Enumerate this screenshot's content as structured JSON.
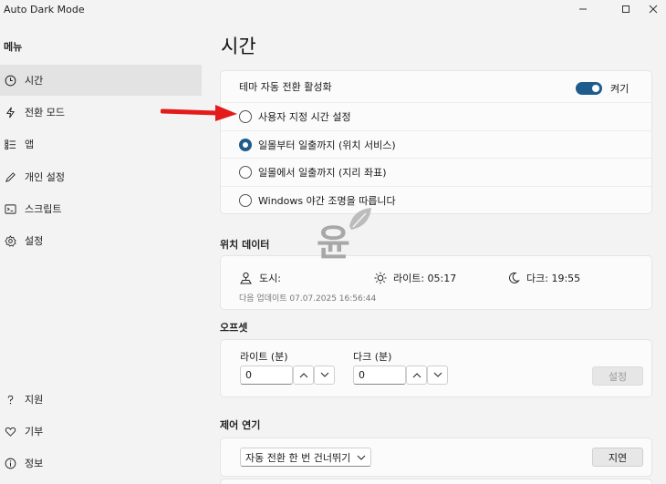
{
  "window": {
    "title": "Auto Dark Mode",
    "controls": [
      "minimize-icon",
      "maximize-icon",
      "close-icon"
    ]
  },
  "sidebar": {
    "heading": "메뉴",
    "items": [
      {
        "label": "시간",
        "icon": "clock-icon",
        "active": true
      },
      {
        "label": "전환 모드",
        "icon": "lightning-icon"
      },
      {
        "label": "앱",
        "icon": "app-list-icon"
      },
      {
        "label": "개인 설정",
        "icon": "pen-icon"
      },
      {
        "label": "스크립트",
        "icon": "script-icon"
      },
      {
        "label": "설정",
        "icon": "gear-icon"
      }
    ],
    "footer": [
      {
        "label": "지원",
        "icon": "help-icon"
      },
      {
        "label": "기부",
        "icon": "heart-icon"
      },
      {
        "label": "정보",
        "icon": "info-icon"
      }
    ]
  },
  "main": {
    "title": "시간",
    "theme_switch": {
      "label": "테마 자동 전환 활성화",
      "state_label": "켜기",
      "on": true
    },
    "schedule_options": [
      {
        "label": "사용자 지정 시간 설정",
        "checked": false
      },
      {
        "label": "일몰부터 일출까지 (위치 서비스)",
        "checked": true
      },
      {
        "label": "일몰에서 일출까지 (지리 좌표)",
        "checked": false
      },
      {
        "label": "Windows 야간 조명을 따릅니다",
        "checked": false
      }
    ],
    "location": {
      "heading": "위치 데이터",
      "city_label": "도시:",
      "light_label": "라이트: 05:17",
      "dark_label": "다크: 19:55",
      "last_update": "다음 업데이트 07.07.2025 16:56:44"
    },
    "offset": {
      "heading": "오프셋",
      "light_label": "라이트 (분)",
      "light_value": "0",
      "dark_label": "다크 (분)",
      "dark_value": "0",
      "apply_label": "설정"
    },
    "postpone": {
      "heading": "제어 연기",
      "select_value": "자동 전환 한 번 건너뛰기",
      "button_label": "지연"
    }
  },
  "watermark_text": "윤",
  "colors": {
    "accent": "#1f5c8c",
    "arrow": "#e31b1b",
    "watermark": "#a8a8a8"
  }
}
